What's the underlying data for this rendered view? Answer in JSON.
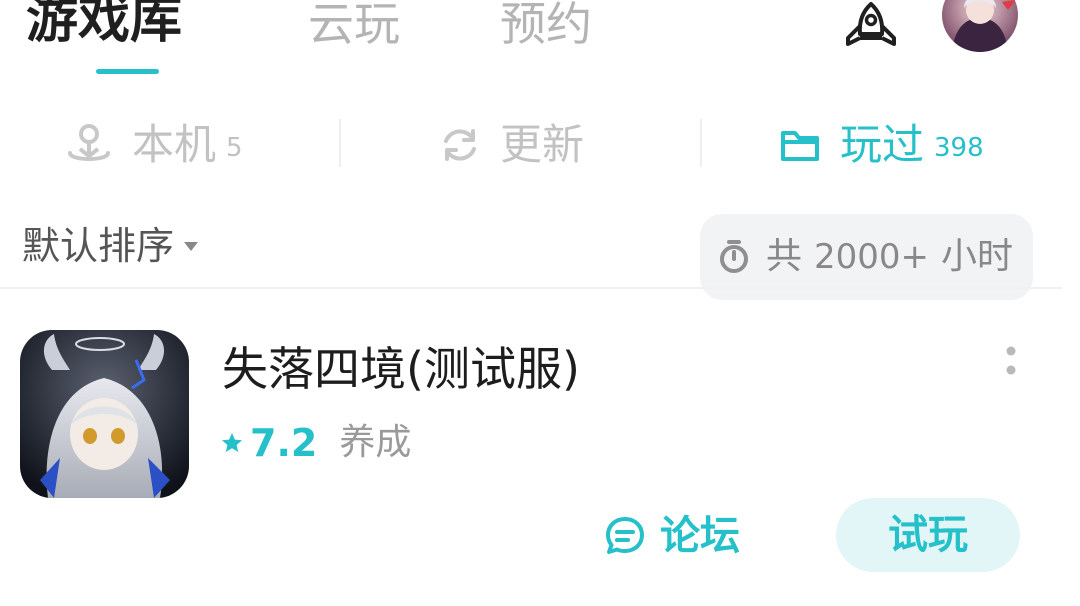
{
  "header": {
    "tabs": [
      {
        "label": "游戏库",
        "active": true
      },
      {
        "label": "云玩",
        "active": false
      },
      {
        "label": "预约",
        "active": false
      }
    ],
    "rocket_icon": "rocket-icon",
    "avatar_icon": "avatar"
  },
  "filters": {
    "local": {
      "label": "本机",
      "count": "5",
      "icon": "download-person-icon"
    },
    "update": {
      "label": "更新",
      "icon": "refresh-icon"
    },
    "played": {
      "label": "玩过",
      "count": "398",
      "icon": "folder-icon",
      "active": true
    }
  },
  "sort": {
    "label": "默认排序",
    "total_time_prefix": "共",
    "total_time_value": "2000+",
    "total_time_unit": "小时"
  },
  "games": [
    {
      "title": "失落四境(测试服)",
      "rating": "7.2",
      "tag": "养成",
      "forum_label": "论坛",
      "try_label": "试玩"
    }
  ],
  "colors": {
    "accent": "#25c0c9",
    "inactive_text": "#c2c2c2",
    "pill_bg": "#f2f3f5",
    "try_bg": "#e3f6f7"
  }
}
